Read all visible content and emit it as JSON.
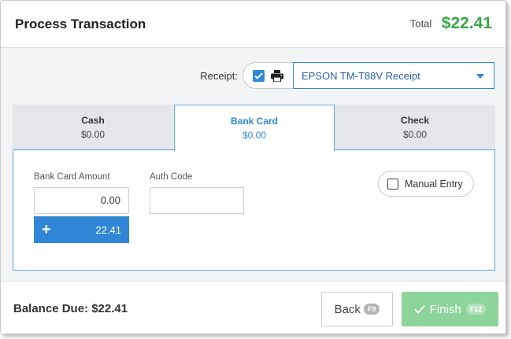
{
  "header": {
    "title": "Process Transaction",
    "total_label": "Total",
    "total_value": "$22.41"
  },
  "receipt": {
    "label": "Receipt:",
    "checked": true,
    "printer": "EPSON TM-T88V Receipt"
  },
  "tabs": [
    {
      "label": "Cash",
      "amount": "$0.00",
      "active": false
    },
    {
      "label": "Bank Card",
      "amount": "$0.00",
      "active": true
    },
    {
      "label": "Check",
      "amount": "$0.00",
      "active": false
    }
  ],
  "bank_card": {
    "amount_label": "Bank Card Amount",
    "amount_value": "0.00",
    "auth_label": "Auth Code",
    "auth_value": "",
    "add_amount": "22.41",
    "manual_entry_label": "Manual Entry",
    "manual_entry_checked": false
  },
  "footer": {
    "balance_due": "Balance Due: $22.41",
    "back_label": "Back",
    "back_key": "F9",
    "finish_label": "Finish",
    "finish_key": "F12"
  },
  "colors": {
    "accent": "#2f87d6",
    "total_green": "#3aa648",
    "finish_green": "#8dd49a"
  },
  "icons": [
    "checkbox-checked-icon",
    "printer-icon",
    "chevron-down-icon",
    "plus-icon",
    "checkbox-icon",
    "checkmark-icon"
  ]
}
